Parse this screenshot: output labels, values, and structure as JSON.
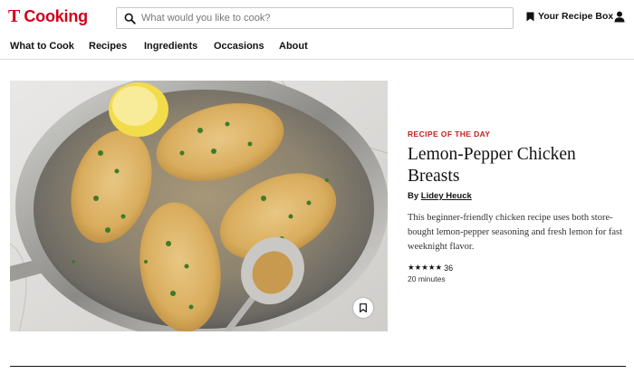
{
  "header": {
    "logo_mark": "T",
    "logo_text": "Cooking",
    "search_placeholder": "What would you like to cook?",
    "recipe_box_label": "Your Recipe Box"
  },
  "nav": {
    "items": [
      "What to Cook",
      "Recipes",
      "Ingredients",
      "Occasions",
      "About"
    ]
  },
  "featured": {
    "kicker": "RECIPE OF THE DAY",
    "title": "Lemon-Pepper Chicken Breasts",
    "byline_prefix": "By",
    "author": "Lidey Heuck",
    "description": "This beginner-friendly chicken recipe uses both store-bought lemon-pepper seasoning and fresh lemon for fast weeknight flavor.",
    "stars": "★★★★★",
    "rating_count": "36",
    "rating_value": 5,
    "time": "20 minutes"
  },
  "colors": {
    "brand_red": "#d0021b",
    "kicker_red": "#c41e1e"
  },
  "icons": [
    "search-icon",
    "bookmark-icon",
    "account-icon",
    "bookmark-outline-icon"
  ]
}
